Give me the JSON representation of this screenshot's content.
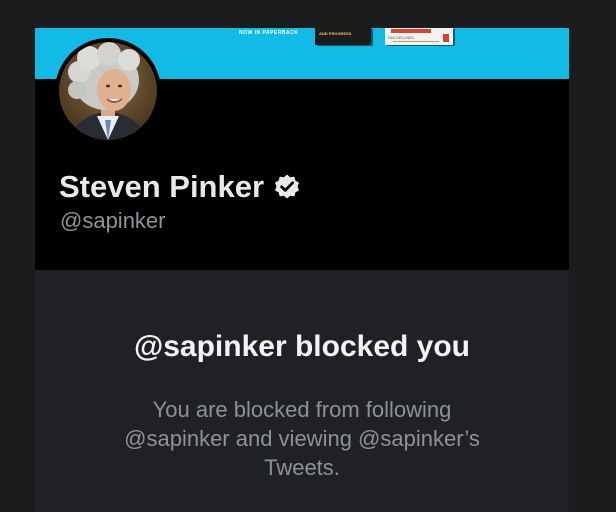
{
  "banner": {
    "caption": "NOW IN PAPERBACK",
    "book_dark_text": "AND PROGRESS",
    "book_light_text": "HAS DECLINED"
  },
  "profile": {
    "display_name": "Steven Pinker",
    "handle": "@sapinker",
    "verified": true,
    "verified_icon": "verified-badge-icon"
  },
  "blocked": {
    "title": "@sapinker blocked you",
    "message_lines": [
      "You are blocked from following",
      "@sapinker and viewing @sapinker’s",
      "Tweets."
    ]
  },
  "colors": {
    "page_background": "#1b1c1e",
    "banner": "#12bae6",
    "card_background": "#000000",
    "panel_background": "#1f2124",
    "primary_text": "#e7e9ea",
    "secondary_text": "#8d9297"
  }
}
